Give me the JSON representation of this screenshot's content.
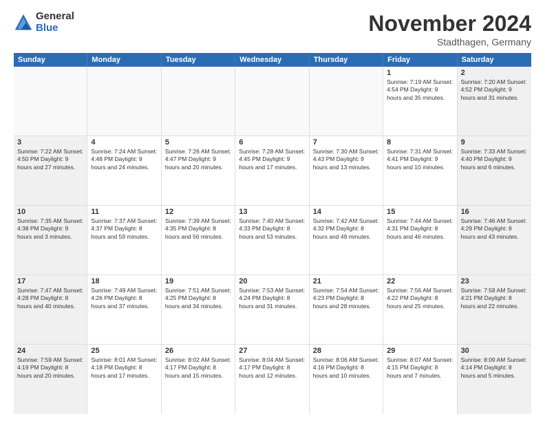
{
  "logo": {
    "general": "General",
    "blue": "Blue"
  },
  "title": "November 2024",
  "location": "Stadthagen, Germany",
  "header_days": [
    "Sunday",
    "Monday",
    "Tuesday",
    "Wednesday",
    "Thursday",
    "Friday",
    "Saturday"
  ],
  "weeks": [
    [
      {
        "day": "",
        "info": "",
        "empty": true
      },
      {
        "day": "",
        "info": "",
        "empty": true
      },
      {
        "day": "",
        "info": "",
        "empty": true
      },
      {
        "day": "",
        "info": "",
        "empty": true
      },
      {
        "day": "",
        "info": "",
        "empty": true
      },
      {
        "day": "1",
        "info": "Sunrise: 7:19 AM\nSunset: 4:54 PM\nDaylight: 9 hours\nand 35 minutes."
      },
      {
        "day": "2",
        "info": "Sunrise: 7:20 AM\nSunset: 4:52 PM\nDaylight: 9 hours\nand 31 minutes.",
        "shaded": true
      }
    ],
    [
      {
        "day": "3",
        "info": "Sunrise: 7:22 AM\nSunset: 4:50 PM\nDaylight: 9 hours\nand 27 minutes.",
        "shaded": true
      },
      {
        "day": "4",
        "info": "Sunrise: 7:24 AM\nSunset: 4:48 PM\nDaylight: 9 hours\nand 24 minutes."
      },
      {
        "day": "5",
        "info": "Sunrise: 7:26 AM\nSunset: 4:47 PM\nDaylight: 9 hours\nand 20 minutes."
      },
      {
        "day": "6",
        "info": "Sunrise: 7:28 AM\nSunset: 4:45 PM\nDaylight: 9 hours\nand 17 minutes."
      },
      {
        "day": "7",
        "info": "Sunrise: 7:30 AM\nSunset: 4:43 PM\nDaylight: 9 hours\nand 13 minutes."
      },
      {
        "day": "8",
        "info": "Sunrise: 7:31 AM\nSunset: 4:41 PM\nDaylight: 9 hours\nand 10 minutes."
      },
      {
        "day": "9",
        "info": "Sunrise: 7:33 AM\nSunset: 4:40 PM\nDaylight: 9 hours\nand 6 minutes.",
        "shaded": true
      }
    ],
    [
      {
        "day": "10",
        "info": "Sunrise: 7:35 AM\nSunset: 4:38 PM\nDaylight: 9 hours\nand 3 minutes.",
        "shaded": true
      },
      {
        "day": "11",
        "info": "Sunrise: 7:37 AM\nSunset: 4:37 PM\nDaylight: 8 hours\nand 59 minutes."
      },
      {
        "day": "12",
        "info": "Sunrise: 7:39 AM\nSunset: 4:35 PM\nDaylight: 8 hours\nand 56 minutes."
      },
      {
        "day": "13",
        "info": "Sunrise: 7:40 AM\nSunset: 4:33 PM\nDaylight: 8 hours\nand 53 minutes."
      },
      {
        "day": "14",
        "info": "Sunrise: 7:42 AM\nSunset: 4:32 PM\nDaylight: 8 hours\nand 49 minutes."
      },
      {
        "day": "15",
        "info": "Sunrise: 7:44 AM\nSunset: 4:31 PM\nDaylight: 8 hours\nand 46 minutes."
      },
      {
        "day": "16",
        "info": "Sunrise: 7:46 AM\nSunset: 4:29 PM\nDaylight: 8 hours\nand 43 minutes.",
        "shaded": true
      }
    ],
    [
      {
        "day": "17",
        "info": "Sunrise: 7:47 AM\nSunset: 4:28 PM\nDaylight: 8 hours\nand 40 minutes.",
        "shaded": true
      },
      {
        "day": "18",
        "info": "Sunrise: 7:49 AM\nSunset: 4:26 PM\nDaylight: 8 hours\nand 37 minutes."
      },
      {
        "day": "19",
        "info": "Sunrise: 7:51 AM\nSunset: 4:25 PM\nDaylight: 8 hours\nand 34 minutes."
      },
      {
        "day": "20",
        "info": "Sunrise: 7:53 AM\nSunset: 4:24 PM\nDaylight: 8 hours\nand 31 minutes."
      },
      {
        "day": "21",
        "info": "Sunrise: 7:54 AM\nSunset: 4:23 PM\nDaylight: 8 hours\nand 28 minutes."
      },
      {
        "day": "22",
        "info": "Sunrise: 7:56 AM\nSunset: 4:22 PM\nDaylight: 8 hours\nand 25 minutes."
      },
      {
        "day": "23",
        "info": "Sunrise: 7:58 AM\nSunset: 4:21 PM\nDaylight: 8 hours\nand 22 minutes.",
        "shaded": true
      }
    ],
    [
      {
        "day": "24",
        "info": "Sunrise: 7:59 AM\nSunset: 4:19 PM\nDaylight: 8 hours\nand 20 minutes.",
        "shaded": true
      },
      {
        "day": "25",
        "info": "Sunrise: 8:01 AM\nSunset: 4:18 PM\nDaylight: 8 hours\nand 17 minutes."
      },
      {
        "day": "26",
        "info": "Sunrise: 8:02 AM\nSunset: 4:17 PM\nDaylight: 8 hours\nand 15 minutes."
      },
      {
        "day": "27",
        "info": "Sunrise: 8:04 AM\nSunset: 4:17 PM\nDaylight: 8 hours\nand 12 minutes."
      },
      {
        "day": "28",
        "info": "Sunrise: 8:06 AM\nSunset: 4:16 PM\nDaylight: 8 hours\nand 10 minutes."
      },
      {
        "day": "29",
        "info": "Sunrise: 8:07 AM\nSunset: 4:15 PM\nDaylight: 8 hours\nand 7 minutes."
      },
      {
        "day": "30",
        "info": "Sunrise: 8:09 AM\nSunset: 4:14 PM\nDaylight: 8 hours\nand 5 minutes.",
        "shaded": true
      }
    ]
  ]
}
